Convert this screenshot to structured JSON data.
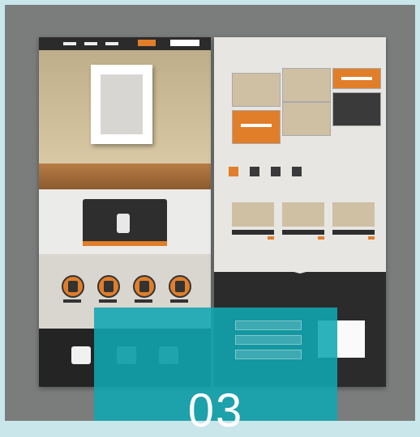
{
  "overlay": {
    "number": "03"
  },
  "colors": {
    "accent": "#e07e2a",
    "dark": "#2b2b2b",
    "teal_overlay": "#10a6b2",
    "background": "#7a7d7c"
  }
}
